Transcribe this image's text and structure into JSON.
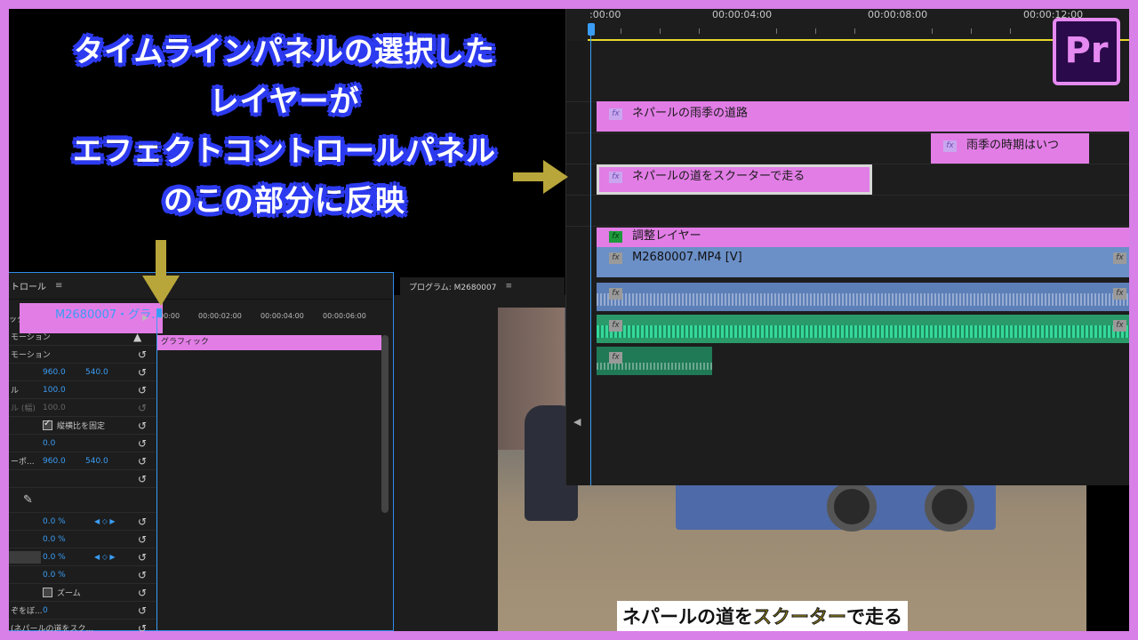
{
  "headline": {
    "lines": [
      "タイムラインパネルの選択した",
      "レイヤーが",
      "エフェクトコントロールパネル",
      "のこの部分に反映"
    ]
  },
  "timeline": {
    "ruler": [
      ":00:00",
      "00:00:04:00",
      "00:00:08:00",
      "00:00:12:00"
    ],
    "clips": {
      "v4": "ネパールの雨季の道路",
      "v3": "雨季の時期はいつ",
      "v2": "ネパールの道をスクーターで走る",
      "adjustment": "調整レイヤー",
      "video": "M2680007.MP4 [V]"
    },
    "fx_label": "fx"
  },
  "effect_controls": {
    "title": "トロール",
    "menu_icon": "≡",
    "sub_label": "ック",
    "clip_name": "M2680007・グラ...",
    "ruler": [
      "00:00",
      "00:00:02:00",
      "00:00:04:00",
      "00:00:06:00"
    ],
    "graphic_label": "グラフィック",
    "rows": [
      {
        "label": "モーション"
      },
      {
        "label": "",
        "v1": "960.0",
        "v2": "540.0"
      },
      {
        "label": "ル",
        "v1": "100.0"
      },
      {
        "label": "ル (幅)",
        "v1": "100.0"
      },
      {
        "label": "",
        "checkbox": "縦横比を固定"
      },
      {
        "label": "",
        "v1": "0.0"
      },
      {
        "label": "ーポ...",
        "v1": "960.0",
        "v2": "540.0"
      },
      {
        "label": ""
      },
      {
        "label": ""
      },
      {
        "label": "",
        "v1": "0.0 %"
      },
      {
        "label": "",
        "v1": "0.0 %"
      },
      {
        "label": "",
        "v1": "0.0 %"
      },
      {
        "label": "",
        "v1": "0.0 %"
      },
      {
        "label": "",
        "checkbox": "ズーム"
      },
      {
        "label": "ぞをぼ...",
        "v1": "0"
      },
      {
        "label": "(ネパールの道をスク..."
      }
    ]
  },
  "program": {
    "title": "プログラム: M2680007",
    "menu_icon": "≡"
  },
  "caption": {
    "before": "ネパールの道を",
    "highlight": "スクーター",
    "after": "で走る"
  },
  "logo": {
    "text": "Pr"
  },
  "colors": {
    "border": "#d87fe8",
    "headline_outline": "#2c3af0",
    "clip_pink": "#e27de6",
    "video_blue": "#6b8fc7",
    "audio_green": "#2a9a6a",
    "arrow": "#b8a63a",
    "accent_blue": "#3a9df5"
  }
}
